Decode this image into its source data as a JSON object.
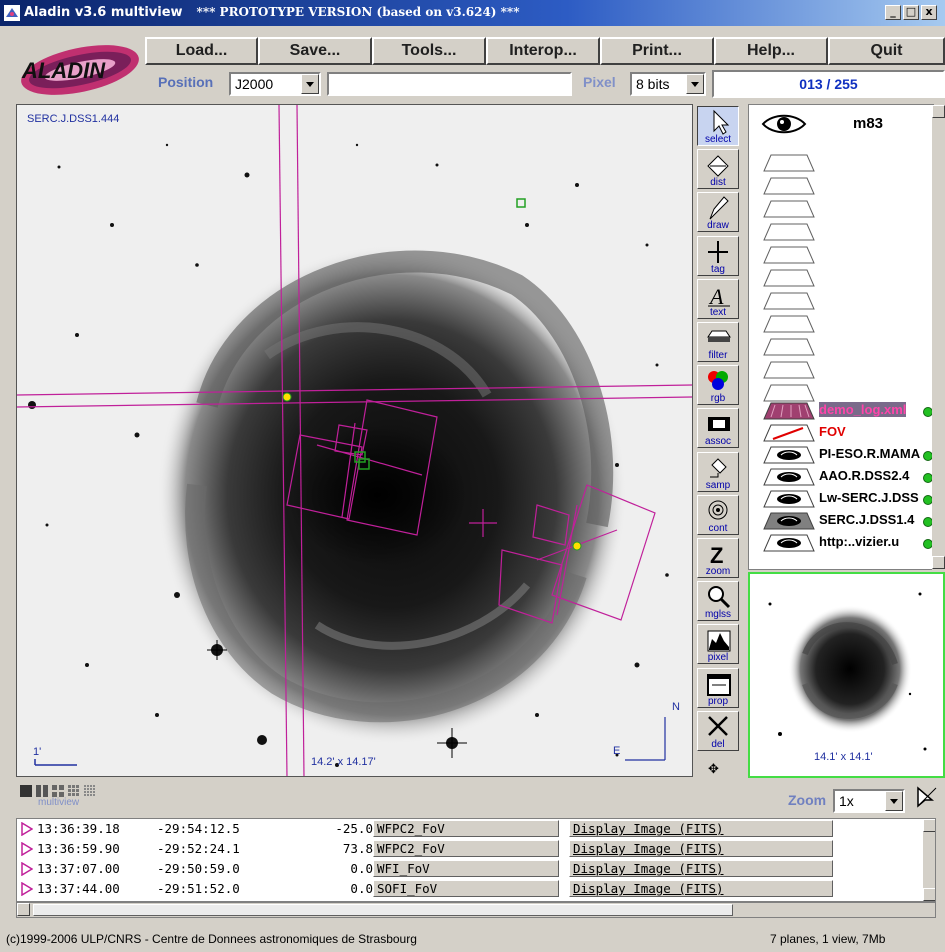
{
  "window": {
    "title": "Aladin v3.6 multiview",
    "subtitle": "*** PROTOTYPE VERSION (based on v3.624) ***",
    "min_label": "_",
    "max_label": "□",
    "close_label": "x"
  },
  "logo": {
    "text": "ALADIN"
  },
  "menu": {
    "load": "Load...",
    "save": "Save...",
    "tools": "Tools...",
    "interop": "Interop...",
    "print": "Print...",
    "help": "Help...",
    "quit": "Quit"
  },
  "position": {
    "label": "Position",
    "frame": "J2000",
    "value": ""
  },
  "pixel": {
    "label": "Pixel",
    "bits": "8 bits",
    "value": "013 / 255"
  },
  "view": {
    "survey_label": "SERC.J.DSS1.444",
    "scale_label": "1'",
    "fov_label": "14.2' x 14.17'",
    "north": "N",
    "east": "E"
  },
  "tools": [
    {
      "id": "select",
      "label": "select",
      "icon": "arrow-pointer-icon"
    },
    {
      "id": "dist",
      "label": "dist",
      "icon": "distance-icon"
    },
    {
      "id": "draw",
      "label": "draw",
      "icon": "pencil-icon"
    },
    {
      "id": "tag",
      "label": "tag",
      "icon": "cross-tag-icon"
    },
    {
      "id": "text",
      "label": "text",
      "icon": "text-a-icon"
    },
    {
      "id": "filter",
      "label": "filter",
      "icon": "filter-icon"
    },
    {
      "id": "rgb",
      "label": "rgb",
      "icon": "rgb-circles-icon"
    },
    {
      "id": "assoc",
      "label": "assoc",
      "icon": "film-icon"
    },
    {
      "id": "samp",
      "label": "samp",
      "icon": "samp-icon"
    },
    {
      "id": "cont",
      "label": "cont",
      "icon": "contour-icon"
    },
    {
      "id": "zoom",
      "label": "zoom",
      "icon": "zoom-z-icon"
    },
    {
      "id": "mglss",
      "label": "mglss",
      "icon": "magnifier-icon"
    },
    {
      "id": "pixel",
      "label": "pixel",
      "icon": "histogram-icon"
    },
    {
      "id": "prop",
      "label": "prop",
      "icon": "properties-icon"
    },
    {
      "id": "del",
      "label": "del",
      "icon": "delete-x-icon"
    }
  ],
  "stack": {
    "target": "m83",
    "planes": [
      {
        "label": "demo_log.xml",
        "color": "#ff44aa",
        "status": "#22c022"
      },
      {
        "label": "FOV",
        "color": "#e00000",
        "status": ""
      },
      {
        "label": "PI-ESO.R.MAMA",
        "color": "#000000",
        "status": "#22c022"
      },
      {
        "label": "AAO.R.DSS2.4",
        "color": "#000000",
        "status": "#22c022"
      },
      {
        "label": "Lw-SERC.J.DSS",
        "color": "#000000",
        "status": "#22c022"
      },
      {
        "label": "SERC.J.DSS1.4",
        "color": "#000000",
        "status": "#22c022"
      },
      {
        "label": "http:..vizier.u",
        "color": "#000000",
        "status": "#22c022"
      }
    ]
  },
  "zoomview": {
    "fov": "14.1' x 14.1'"
  },
  "multiview": {
    "label": "multiview"
  },
  "zoom": {
    "label": "Zoom",
    "value": "1x"
  },
  "table": {
    "rows": [
      {
        "ra": "13:36:39.18",
        "dec": "-29:54:12.5",
        "angle": "-25.0",
        "name": "WFPC2_FoV",
        "action": "Display Image (FITS)"
      },
      {
        "ra": "13:36:59.90",
        "dec": "-29:52:24.1",
        "angle": "73.8",
        "name": "WFPC2_FoV",
        "action": "Display Image (FITS)"
      },
      {
        "ra": "13:37:07.00",
        "dec": "-29:50:59.0",
        "angle": "0.0",
        "name": "WFI_FoV",
        "action": "Display Image (FITS)"
      },
      {
        "ra": "13:37:44.00",
        "dec": "-29:51:52.0",
        "angle": "0.0",
        "name": "SOFI_FoV",
        "action": "Display Image (FITS)"
      }
    ]
  },
  "status": {
    "copyright": "(c)1999-2006 ULP/CNRS - Centre de Donnees astronomiques de Strasbourg",
    "summary": "7 planes, 1 view, 7Mb"
  },
  "colors": {
    "overlay": "#c0209a",
    "highlight_green": "#22c022",
    "label_blue": "#2030a0"
  }
}
